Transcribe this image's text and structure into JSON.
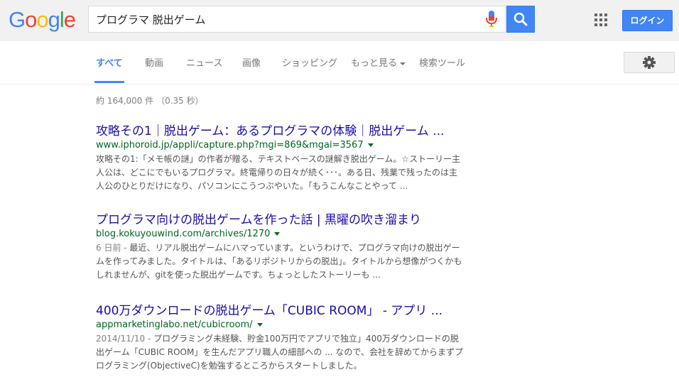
{
  "header": {
    "logo_letters": [
      {
        "ch": "G",
        "color": "#4285f4"
      },
      {
        "ch": "o",
        "color": "#ea4335"
      },
      {
        "ch": "o",
        "color": "#fbbc05"
      },
      {
        "ch": "g",
        "color": "#4285f4"
      },
      {
        "ch": "l",
        "color": "#34a853"
      },
      {
        "ch": "e",
        "color": "#ea4335"
      }
    ],
    "search_value": "プログラマ 脱出ゲーム",
    "mic_icon": "microphone-icon",
    "search_icon": "magnifier-icon",
    "apps_icon": "apps-grid-icon",
    "login_label": "ログイン"
  },
  "tabs": {
    "all": "すべて",
    "video": "動画",
    "news": "ニュース",
    "images": "画像",
    "shopping": "ショッピング",
    "more": "もっと見る",
    "tools": "検索ツール"
  },
  "settings_icon": "gear-icon",
  "stats": "約 164,000 件 （0.35 秒）",
  "results": [
    {
      "title": "攻略その1｜脱出ゲーム：あるプログラマの体験｜脱出ゲーム ...",
      "url": "www.iphoroid.jp/appli/capture.php?mgi=869&mgai=3567",
      "date": "",
      "snippet": "攻略その1:「メモ帳の謎」の作者が贈る、テキストベースの謎解き脱出ゲーム。☆ストーリー主人公は、どこにでもいるプログラマ。終電帰りの日々が続く･･･。ある日、残業で残ったのは主人公のひとりだけになり、パソコンにこうつぶやいた。「もうこんなことやって ..."
    },
    {
      "title": "プログラマ向けの脱出ゲームを作った話 | 黒曜の吹き溜まり",
      "url": "blog.kokuyouwind.com/archives/1270",
      "date": "6 日前 - ",
      "snippet": "最近、リアル脱出ゲームにハマっています。というわけで、プログラマ向けの脱出ゲームを作ってみました。タイトルは、「あるリポジトリからの脱出」。タイトルから想像がつくかもしれませんが、gitを使った脱出ゲームです。ちょっとしたストーリーも ..."
    },
    {
      "title": "400万ダウンロードの脱出ゲーム「CUBIC ROOM」 - アプリ ...",
      "url": "appmarketinglabo.net/cubicroom/",
      "date": "2014/11/10 - ",
      "snippet": "プログラミング未経験、貯金100万円でアプリで独立」400万ダウンロードの脱出ゲーム「CUBIC ROOM」を生んだアプリ職人の細部への ... なので、会社を辞めてからまずプログラミング(ObjectiveC)を勉強するところからスタートしました。"
    }
  ]
}
